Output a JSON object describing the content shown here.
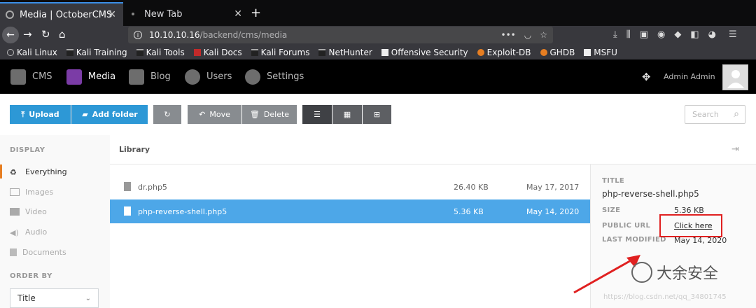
{
  "browser": {
    "tabs": [
      {
        "title": "Media | OctoberCMS"
      },
      {
        "title": "New Tab"
      }
    ],
    "new_tab": "+",
    "url": {
      "host": "10.10.10.16",
      "path": "/backend/cms/media"
    },
    "bookmarks": [
      "Kali Linux",
      "Kali Training",
      "Kali Tools",
      "Kali Docs",
      "Kali Forums",
      "NetHunter",
      "Offensive Security",
      "Exploit-DB",
      "GHDB",
      "MSFU"
    ]
  },
  "cms": {
    "nav": [
      "CMS",
      "Media",
      "Blog",
      "Users",
      "Settings"
    ],
    "admin_name": "Admin Admin"
  },
  "toolbar": {
    "upload": "Upload",
    "add_folder": "Add folder",
    "move": "Move",
    "delete": "Delete",
    "search_placeholder": "Search"
  },
  "sidebar": {
    "display_heading": "DISPLAY",
    "items": [
      "Everything",
      "Images",
      "Video",
      "Audio",
      "Documents"
    ],
    "order_heading": "ORDER BY",
    "order_value": "Title"
  },
  "library": {
    "title": "Library",
    "files": [
      {
        "name": "dr.php5",
        "size": "26.40 KB",
        "date": "May 17, 2017"
      },
      {
        "name": "php-reverse-shell.php5",
        "size": "5.36 KB",
        "date": "May 14, 2020"
      }
    ]
  },
  "details": {
    "title_label": "TITLE",
    "title_value": "php-reverse-shell.php5",
    "size_label": "SIZE",
    "size_value": "5.36 KB",
    "url_label": "PUBLIC URL",
    "url_value": "Click here",
    "modified_label": "LAST MODIFIED",
    "modified_value": "May 14, 2020"
  },
  "watermark": {
    "text": "大余安全",
    "url": "https://blog.csdn.net/qq_34801745"
  },
  "colors": {
    "accent": "#2d98d6",
    "selected_row": "#4da7e8",
    "highlight_box": "#e02020"
  }
}
